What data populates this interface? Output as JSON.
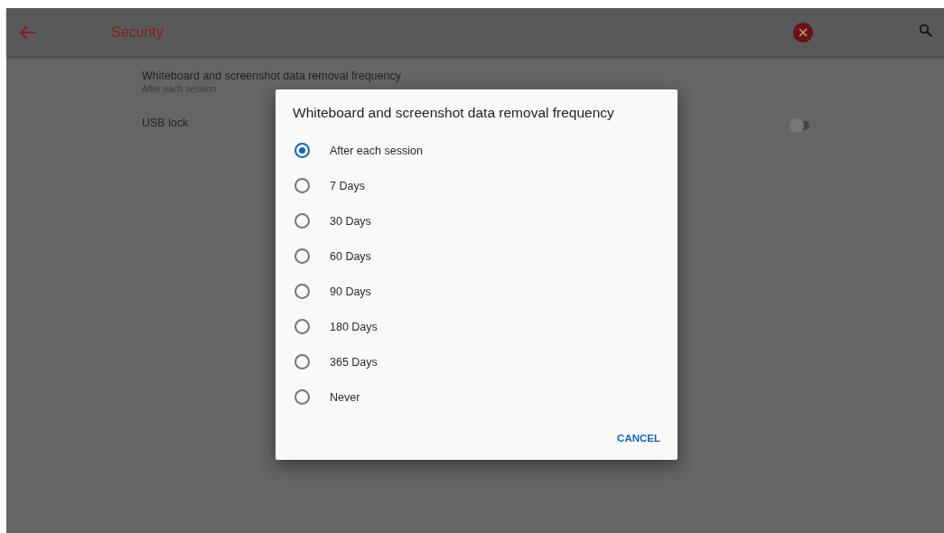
{
  "toolbar": {
    "title": "Security"
  },
  "settings": [
    {
      "kind": "choice",
      "title": "Whiteboard and screenshot data removal frequency",
      "summary": "After each session"
    },
    {
      "kind": "switch",
      "title": "USB lock",
      "on": false
    }
  ],
  "dialog": {
    "title": "Whiteboard and screenshot data removal frequency",
    "options": [
      {
        "label": "After each session",
        "selected": true
      },
      {
        "label": "7 Days",
        "selected": false
      },
      {
        "label": "30 Days",
        "selected": false
      },
      {
        "label": "60 Days",
        "selected": false
      },
      {
        "label": "90 Days",
        "selected": false
      },
      {
        "label": "180 Days",
        "selected": false
      },
      {
        "label": "365 Days",
        "selected": false
      },
      {
        "label": "Never",
        "selected": false
      }
    ],
    "buttons": [
      "CANCEL"
    ]
  }
}
